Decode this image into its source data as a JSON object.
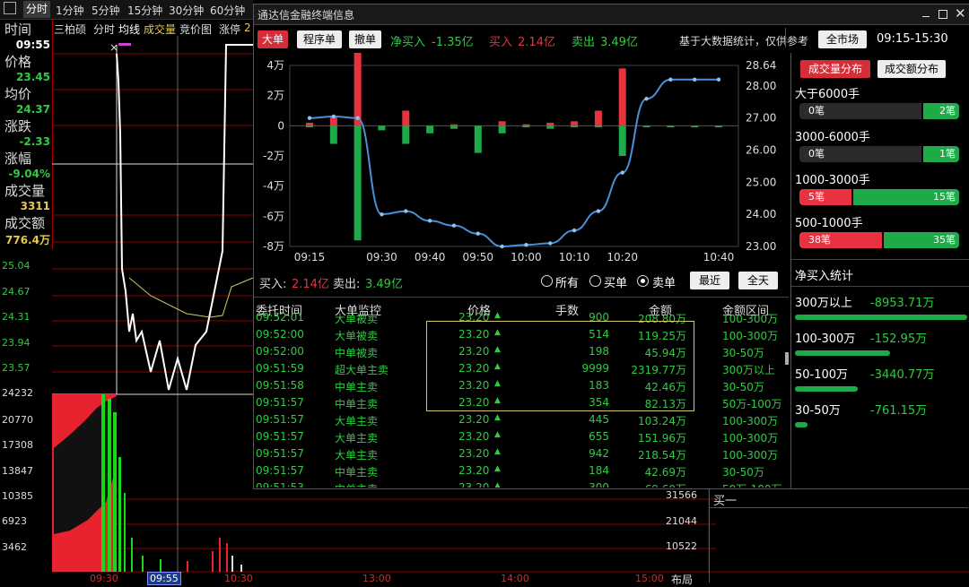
{
  "period_tabs": [
    "分时",
    "1分钟",
    "5分钟",
    "15分钟",
    "30分钟",
    "60分钟"
  ],
  "left_info": {
    "time_label": "时间",
    "time_value": "09:55",
    "price_label": "价格",
    "price_value": "23.45",
    "avg_label": "均价",
    "avg_value": "24.37",
    "change_label": "涨跌",
    "change_value": "-2.33",
    "pct_label": "涨幅",
    "pct_value": "-9.04%",
    "vol_label": "成交量",
    "vol_value": "3311",
    "amt_label": "成交额",
    "amt_value": "776.4万"
  },
  "sub_tabs": [
    "三柏硕",
    "分时",
    "均线",
    "成交量",
    "竞价图",
    "涨停"
  ],
  "sub_tab_extra": "2",
  "price_axis": [
    "25.04",
    "24.67",
    "24.31",
    "23.94",
    "23.57"
  ],
  "vol_axis": [
    "24232",
    "20770",
    "17308",
    "13847",
    "10385",
    "6923",
    "3462"
  ],
  "bottom_right_axis": [
    "31566",
    "21044",
    "10522"
  ],
  "time_axis": [
    "09:30",
    "09:55",
    "10:30",
    "13:00",
    "14:00",
    "15:00"
  ],
  "buy_one": "买一",
  "bottom_right_label": "布局",
  "popup": {
    "title": "通达信金融终端信息",
    "filter_buttons": [
      "大单",
      "程序单",
      "撤单"
    ],
    "net_buy_label": "净买入",
    "net_buy_value": "-1.35亿",
    "buy_label": "买入",
    "buy_value": "2.14亿",
    "sell_label": "卖出",
    "sell_value": "3.49亿",
    "note": "基于大数据统计，仅供参考",
    "market_button": "全市场",
    "time_range": "09:15-15:30",
    "chart_footer": {
      "buy_label": "买入:",
      "buy_value": "2.14亿",
      "sell_label": "卖出:",
      "sell_value": "3.49亿"
    },
    "radio": [
      {
        "label": "所有",
        "selected": false
      },
      {
        "label": "买单",
        "selected": false
      },
      {
        "label": "卖单",
        "selected": true
      }
    ],
    "range_buttons": [
      "最近",
      "全天"
    ],
    "table_headers": [
      "委托时间",
      "大单监控",
      "价格",
      "手数",
      "金额",
      "金额区间"
    ],
    "table_rows": [
      {
        "time": "09:52:01",
        "type": "大单被卖",
        "price": "23.20",
        "lots": "900",
        "amount": "208.80万",
        "range": "100-300万"
      },
      {
        "time": "09:52:00",
        "type": "大单被卖",
        "price": "23.20",
        "lots": "514",
        "amount": "119.25万",
        "range": "100-300万"
      },
      {
        "time": "09:52:00",
        "type": "中单被卖",
        "price": "23.20",
        "lots": "198",
        "amount": "45.94万",
        "range": "30-50万"
      },
      {
        "time": "09:51:59",
        "type": "超大单主卖",
        "price": "23.20",
        "lots": "9999",
        "amount": "2319.77万",
        "range": "300万以上"
      },
      {
        "time": "09:51:58",
        "type": "中单主卖",
        "price": "23.20",
        "lots": "183",
        "amount": "42.46万",
        "range": "30-50万"
      },
      {
        "time": "09:51:57",
        "type": "中单主卖",
        "price": "23.20",
        "lots": "354",
        "amount": "82.13万",
        "range": "50万-100万"
      },
      {
        "time": "09:51:57",
        "type": "大单主卖",
        "price": "23.20",
        "lots": "445",
        "amount": "103.24万",
        "range": "100-300万"
      },
      {
        "time": "09:51:57",
        "type": "大单主卖",
        "price": "23.20",
        "lots": "655",
        "amount": "151.96万",
        "range": "100-300万"
      },
      {
        "time": "09:51:57",
        "type": "大单主卖",
        "price": "23.20",
        "lots": "942",
        "amount": "218.54万",
        "range": "100-300万"
      },
      {
        "time": "09:51:57",
        "type": "中单主卖",
        "price": "23.20",
        "lots": "184",
        "amount": "42.69万",
        "range": "30-50万"
      },
      {
        "time": "09:51:53",
        "type": "中单主卖",
        "price": "23.20",
        "lots": "300",
        "amount": "69.60万",
        "range": "50万-100万"
      }
    ],
    "dist_tabs": [
      "成交量分布",
      "成交额分布"
    ],
    "dist_rows": [
      {
        "label": "大于6000手",
        "left": "0笔",
        "right": "2笔",
        "left_frac": 0.8
      },
      {
        "label": "3000-6000手",
        "left": "0笔",
        "right": "1笔",
        "left_frac": 0.8
      },
      {
        "label": "1000-3000手",
        "left": "5笔",
        "right": "15笔",
        "left_frac": 0.33
      },
      {
        "label": "500-1000手",
        "left": "38笔",
        "right": "35笔",
        "left_frac": 0.52
      }
    ],
    "net_title": "净买入统计",
    "net_rows": [
      {
        "label": "300万以上",
        "value": "-8953.71万",
        "frac": 1.0
      },
      {
        "label": "100-300万",
        "value": "-152.95万",
        "frac": 0.55
      },
      {
        "label": "50-100万",
        "value": "-3440.77万",
        "frac": 0.37
      },
      {
        "label": "30-50万",
        "value": "-761.15万",
        "frac": 0.07
      }
    ]
  },
  "chart_data": {
    "type": "bar",
    "x": [
      "09:15",
      "09:20",
      "09:25",
      "09:30",
      "09:35",
      "09:40",
      "09:45",
      "09:50",
      "09:55",
      "10:00",
      "10:05",
      "10:10",
      "10:15",
      "10:20",
      "10:25",
      "10:30",
      "10:35",
      "10:40"
    ],
    "x_ticks": [
      "09:15",
      "09:30",
      "09:40",
      "09:50",
      "10:00",
      "10:10",
      "10:20",
      "10:40"
    ],
    "series": [
      {
        "values": [
          0.2,
          0.6,
          8,
          0,
          1,
          0,
          0.1,
          0,
          0.3,
          0.1,
          0.2,
          0.3,
          1,
          3.8,
          0,
          0,
          0,
          0
        ]
      },
      {
        "values": [
          -0.1,
          -1.2,
          -7.6,
          -0.3,
          -1.2,
          -0.5,
          -0.2,
          -1.8,
          -0.5,
          -0.1,
          -0.2,
          -0.1,
          -0.1,
          -2,
          -0.1,
          -0.1,
          -0.1,
          -0.1
        ]
      },
      {
        "values": [
          27.0,
          27.05,
          27.0,
          24.0,
          24.1,
          23.8,
          23.65,
          23.4,
          23.0,
          23.05,
          23.1,
          23.5,
          24.1,
          25.3,
          27.6,
          28.2,
          28.2,
          28.2
        ]
      }
    ],
    "y_left_ticks": [
      "4万",
      "2万",
      "0",
      "-2万",
      "-4万",
      "-6万",
      "-8万"
    ],
    "y_left_range": [
      -8,
      4
    ],
    "y_right_ticks": [
      "28.64",
      "28.00",
      "27.00",
      "26.00",
      "25.00",
      "24.00",
      "23.00"
    ],
    "y_right_range": [
      23.0,
      28.64
    ],
    "colors": {
      "buy": "#e8323f",
      "sell": "#1faa4a",
      "line": "#4a90d9"
    }
  }
}
